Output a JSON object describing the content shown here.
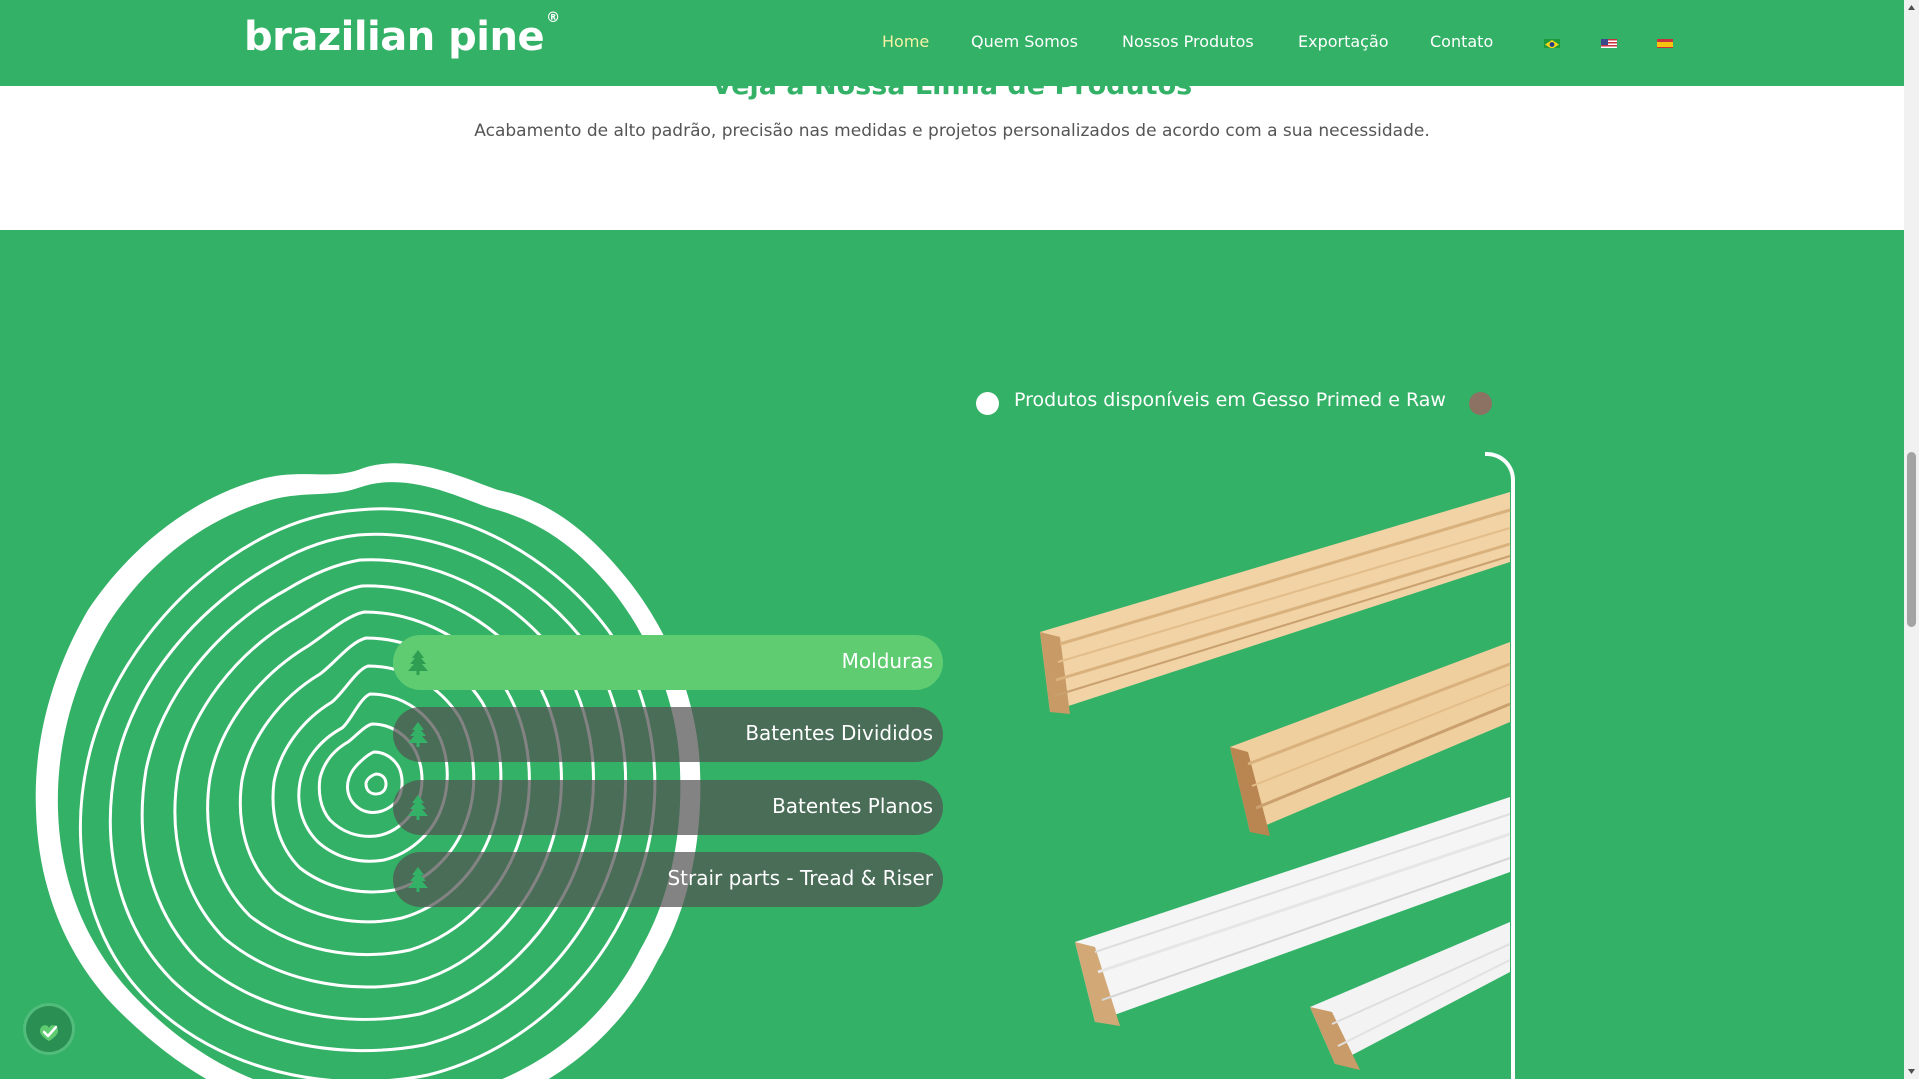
{
  "header": {
    "logo": "brazilian pine",
    "logo_mark": "®",
    "nav": [
      "Home",
      "Quem Somos",
      "Nossos Produtos",
      "Exportação",
      "Contato"
    ],
    "active_nav": "Home",
    "languages": [
      "brazil-flag-icon",
      "usa-flag-icon",
      "spain-flag-icon"
    ]
  },
  "intro": {
    "title": "Veja a Nossa Linha de Produtos",
    "subtitle": "Acabamento de alto padrão, precisão nas medidas e projetos personalizados de acordo com a sua necessidade."
  },
  "products": {
    "items": [
      "Molduras",
      "Batentes Divididos",
      "Batentes Planos",
      "Strair parts - Tread & Riser"
    ],
    "active_index": 0,
    "availability": "Produtos disponíveis em Gesso Primed e Raw"
  },
  "colors": {
    "brand_green": "#33b166",
    "active_item": "#5fcc71",
    "inactive_item": "#535353",
    "primed_dot": "#ffffff",
    "raw_dot": "#8c7263"
  },
  "icons": {
    "tree": "pine-tree-icon",
    "accessibility": "accessibility-icon"
  }
}
